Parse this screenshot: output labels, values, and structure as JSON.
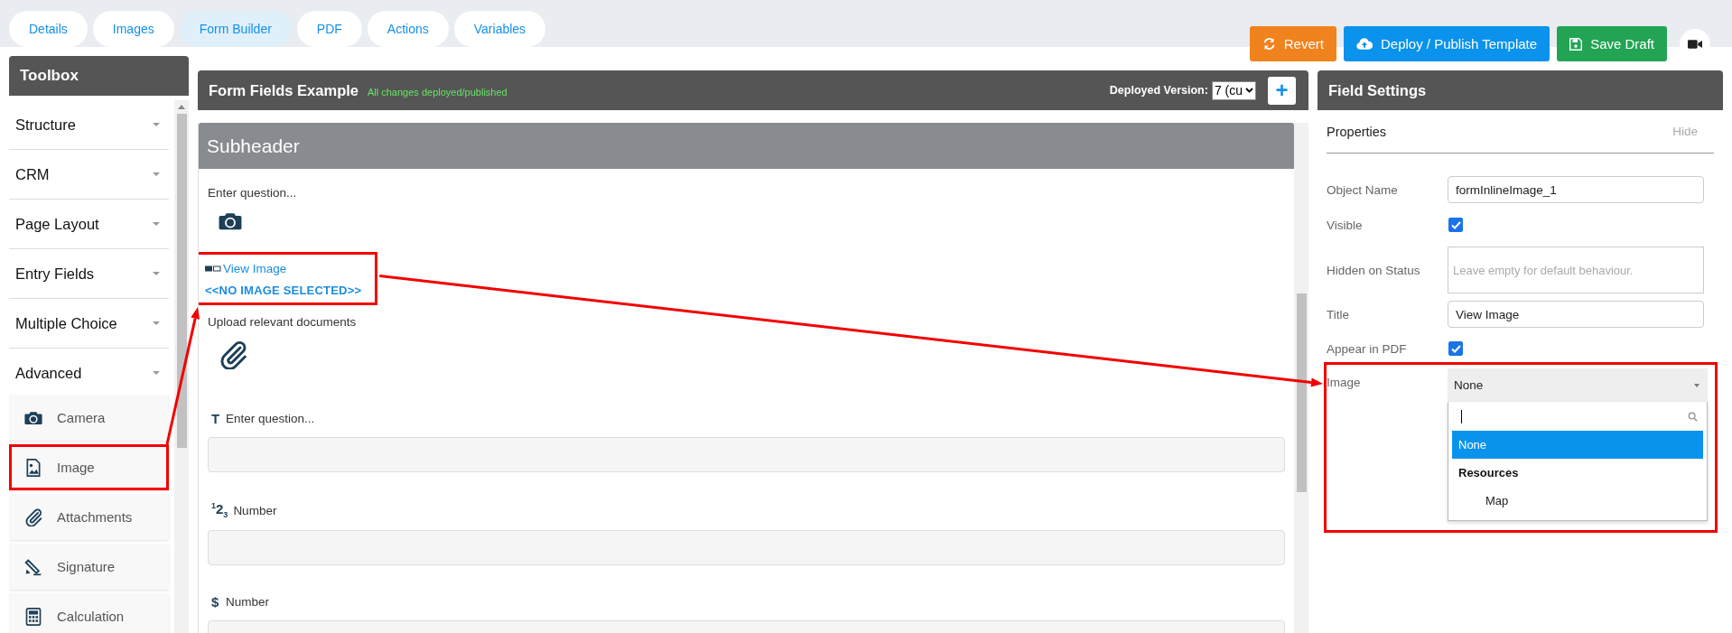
{
  "tabs": [
    {
      "label": "Details",
      "selected": false
    },
    {
      "label": "Images",
      "selected": false
    },
    {
      "label": "Form Builder",
      "selected": true
    },
    {
      "label": "PDF",
      "selected": false
    },
    {
      "label": "Actions",
      "selected": false
    },
    {
      "label": "Variables",
      "selected": false
    }
  ],
  "actions": [
    {
      "kind": "revert",
      "label": "Revert"
    },
    {
      "kind": "deploy",
      "label": "Deploy / Publish Template"
    },
    {
      "kind": "save",
      "label": "Save Draft"
    },
    {
      "kind": "video"
    }
  ],
  "toolbox": {
    "title": "Toolbox",
    "categories": [
      {
        "label": "Structure"
      },
      {
        "label": "CRM"
      },
      {
        "label": "Page Layout"
      },
      {
        "label": "Entry Fields"
      },
      {
        "label": "Multiple Choice"
      },
      {
        "label": "Advanced"
      }
    ],
    "tools": [
      {
        "kind": "camera",
        "label": "Camera",
        "highlighted": false
      },
      {
        "kind": "image",
        "label": "Image",
        "highlighted": true
      },
      {
        "kind": "attachment",
        "label": "Attachments",
        "highlighted": false
      },
      {
        "kind": "signature",
        "label": "Signature",
        "highlighted": false
      },
      {
        "kind": "calculation",
        "label": "Calculation",
        "highlighted": false
      }
    ]
  },
  "form": {
    "title": "Form Fields Example",
    "status": "All changes deployed/published",
    "deployed_version": {
      "label": "Deployed Version:",
      "value": "7 (cu"
    },
    "add_button": "+",
    "subheader": "Subheader",
    "fields": [
      {
        "kind": "camera",
        "label": "Enter question...",
        "highlighted": false
      },
      {
        "kind": "image",
        "title": "View Image",
        "value": "<<NO IMAGE SELECTED>>",
        "highlighted": true
      },
      {
        "kind": "attachment",
        "label": "Upload relevant documents",
        "highlighted": false
      },
      {
        "kind": "text",
        "icon": "T",
        "label": "Enter question...",
        "highlighted": false
      },
      {
        "kind": "text",
        "icon": "$^{1}$2$_{3}$",
        "label": "Number",
        "highlighted": false
      },
      {
        "kind": "text",
        "icon": "$",
        "label": "Number",
        "highlighted": false
      }
    ]
  },
  "settings": {
    "title": "Field Settings",
    "section": "Properties",
    "hide_link": "Hide",
    "rows": [
      {
        "kind": "input",
        "label": "Object Name",
        "value": "formInlineImage_1",
        "highlighted": false
      },
      {
        "kind": "checkbox",
        "label": "Visible",
        "checked": true,
        "highlighted": false
      },
      {
        "kind": "textarea",
        "label": "Hidden on Status",
        "placeholder": "Leave empty for default behaviour.",
        "highlighted": false
      },
      {
        "kind": "input",
        "label": "Title",
        "value": "View Image",
        "highlighted": false
      },
      {
        "kind": "checkbox",
        "label": "Appear in PDF",
        "checked": true,
        "highlighted": false
      },
      {
        "kind": "select",
        "label": "Image",
        "value": "None",
        "open": true,
        "highlighted": true,
        "options": [
          {
            "kind": "option",
            "label": "None",
            "selected": true
          },
          {
            "kind": "group",
            "label": "Resources",
            "children": [
              {
                "kind": "option",
                "label": "Map",
                "selected": false
              }
            ]
          }
        ]
      }
    ]
  }
}
